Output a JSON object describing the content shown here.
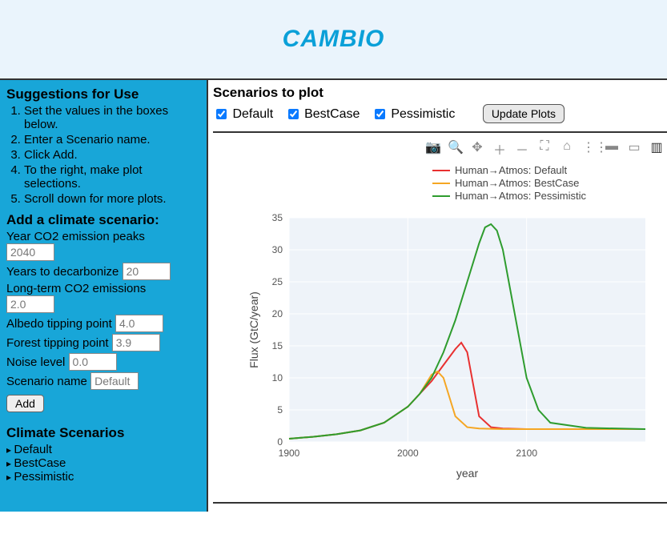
{
  "header": {
    "title": "CAMBIO"
  },
  "sidebar": {
    "suggestions_title": "Suggestions for Use",
    "suggestions": [
      "Set the values in the boxes below.",
      "Enter a Scenario name.",
      "Click Add.",
      "To the right, make plot selections.",
      "Scroll down for more plots."
    ],
    "add_title": "Add a climate scenario:",
    "fields": {
      "year_peak": {
        "label": "Year CO2 emission peaks",
        "value": "2040"
      },
      "years_decarb": {
        "label": "Years to decarbonize",
        "value": "20"
      },
      "lt_emissions": {
        "label": "Long-term CO2 emissions",
        "value": "2.0"
      },
      "albedo": {
        "label": "Albedo tipping point",
        "value": "4.0"
      },
      "forest": {
        "label": "Forest tipping point",
        "value": "3.9"
      },
      "noise": {
        "label": "Noise level",
        "value": "0.0"
      },
      "name": {
        "label": "Scenario name",
        "value": "Default"
      }
    },
    "add_button": "Add",
    "scenarios_title": "Climate Scenarios",
    "scenarios": [
      "Default",
      "BestCase",
      "Pessimistic"
    ]
  },
  "main": {
    "section_title": "Scenarios to plot",
    "checkboxes": [
      {
        "label": "Default",
        "checked": true
      },
      {
        "label": "BestCase",
        "checked": true
      },
      {
        "label": "Pessimistic",
        "checked": true
      }
    ],
    "update_button": "Update Plots"
  },
  "chart_data": {
    "type": "line",
    "title": "",
    "xlabel": "year",
    "ylabel": "Flux  (GtC/year)",
    "xlim": [
      1900,
      2200
    ],
    "ylim": [
      0,
      35
    ],
    "xticks": [
      1900,
      2000,
      2100
    ],
    "yticks": [
      0,
      5,
      10,
      15,
      20,
      25,
      30,
      35
    ],
    "legend": [
      {
        "name": "Human→Atmos: Default",
        "color": "#e83030"
      },
      {
        "name": "Human→Atmos: BestCase",
        "color": "#f5a623"
      },
      {
        "name": "Human→Atmos: Pessimistic",
        "color": "#2e9c2e"
      }
    ],
    "series": [
      {
        "name": "Default",
        "color": "#e83030",
        "x": [
          1900,
          1920,
          1940,
          1960,
          1980,
          2000,
          2010,
          2020,
          2030,
          2040,
          2045,
          2050,
          2055,
          2060,
          2070,
          2080,
          2100,
          2150,
          2200
        ],
        "y": [
          0.5,
          0.8,
          1.2,
          1.8,
          3.0,
          5.5,
          7.5,
          9.5,
          12.0,
          14.5,
          15.5,
          14.0,
          9.0,
          4.0,
          2.3,
          2.1,
          2.0,
          2.0,
          2.0
        ]
      },
      {
        "name": "BestCase",
        "color": "#f5a623",
        "x": [
          1900,
          1920,
          1940,
          1960,
          1980,
          2000,
          2010,
          2015,
          2020,
          2025,
          2030,
          2035,
          2040,
          2050,
          2060,
          2080,
          2100,
          2150,
          2200
        ],
        "y": [
          0.5,
          0.8,
          1.2,
          1.8,
          3.0,
          5.5,
          7.5,
          9.0,
          10.5,
          11.0,
          10.0,
          7.0,
          4.0,
          2.3,
          2.1,
          2.0,
          2.0,
          2.0,
          2.0
        ]
      },
      {
        "name": "Pessimistic",
        "color": "#2e9c2e",
        "x": [
          1900,
          1920,
          1940,
          1960,
          1980,
          2000,
          2010,
          2020,
          2030,
          2040,
          2050,
          2060,
          2065,
          2070,
          2075,
          2080,
          2090,
          2100,
          2110,
          2120,
          2150,
          2200
        ],
        "y": [
          0.5,
          0.8,
          1.2,
          1.8,
          3.0,
          5.5,
          7.5,
          10.0,
          14.0,
          19.0,
          25.0,
          31.0,
          33.5,
          34.0,
          33.0,
          30.0,
          20.0,
          10.0,
          5.0,
          3.0,
          2.2,
          2.0
        ]
      }
    ]
  }
}
